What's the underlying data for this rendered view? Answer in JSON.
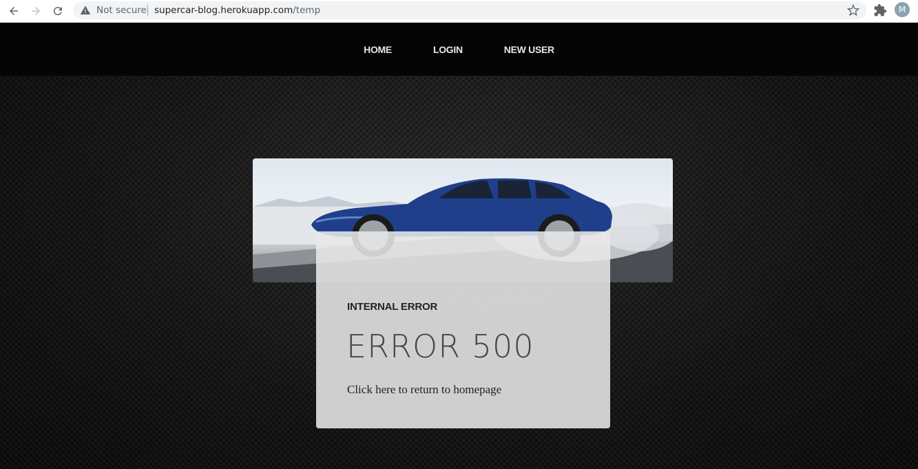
{
  "browser": {
    "security_label": "Not secure",
    "url_host": "supercar-blog.herokuapp.com",
    "url_path": "/temp",
    "profile_initial": "M"
  },
  "nav": {
    "items": [
      {
        "label": "HOME"
      },
      {
        "label": "LOGIN"
      },
      {
        "label": "NEW USER"
      }
    ]
  },
  "error_card": {
    "kicker": "INTERNAL ERROR",
    "title": "ERROR 500",
    "link_text": "Click here to return to homepage"
  },
  "colors": {
    "car_blue": "#1f3f8a",
    "nav_bg": "#050505",
    "card_bg": "#e8e8e8"
  }
}
